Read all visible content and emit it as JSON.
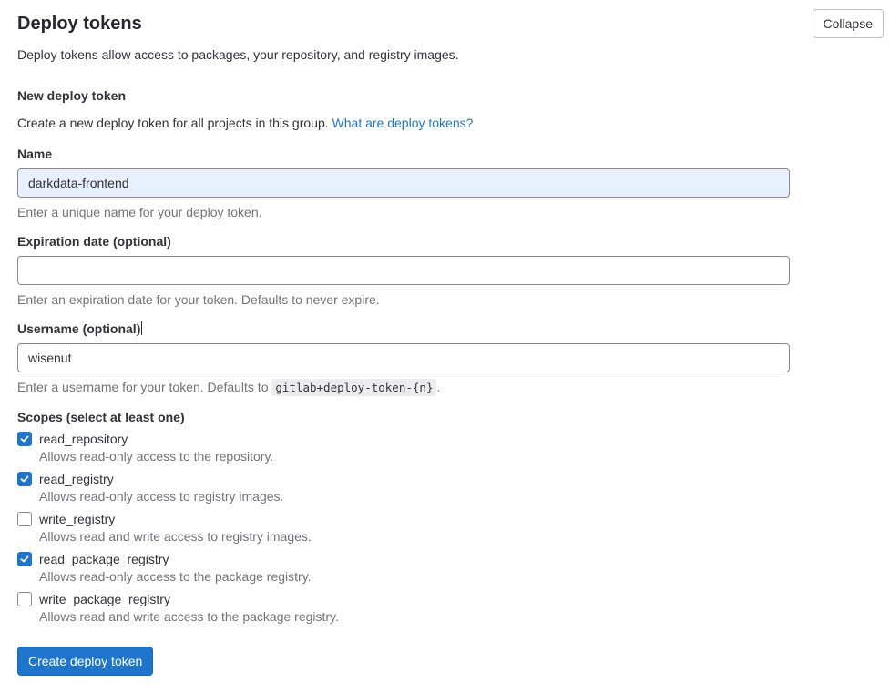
{
  "header": {
    "title": "Deploy tokens",
    "collapse_label": "Collapse",
    "description": "Deploy tokens allow access to packages, your repository, and registry images."
  },
  "new_token": {
    "heading": "New deploy token",
    "intro_text": "Create a new deploy token for all projects in this group.",
    "intro_link": "What are deploy tokens?"
  },
  "name_field": {
    "label": "Name",
    "value": "darkdata-frontend",
    "help": "Enter a unique name for your deploy token."
  },
  "expiration_field": {
    "label": "Expiration date (optional)",
    "value": "",
    "help": "Enter an expiration date for your token. Defaults to never expire."
  },
  "username_field": {
    "label": "Username (optional)",
    "value": "wisenut",
    "help_prefix": "Enter a username for your token. Defaults to",
    "help_code": "gitlab+deploy-token-{n}",
    "help_suffix": "."
  },
  "scopes": {
    "heading": "Scopes (select at least one)",
    "items": [
      {
        "name": "read_repository",
        "description": "Allows read-only access to the repository.",
        "checked": true
      },
      {
        "name": "read_registry",
        "description": "Allows read-only access to registry images.",
        "checked": true
      },
      {
        "name": "write_registry",
        "description": "Allows read and write access to registry images.",
        "checked": false
      },
      {
        "name": "read_package_registry",
        "description": "Allows read-only access to the package registry.",
        "checked": true
      },
      {
        "name": "write_package_registry",
        "description": "Allows read and write access to the package registry.",
        "checked": false
      }
    ]
  },
  "submit_label": "Create deploy token",
  "colors": {
    "accent": "#1f75cb",
    "autofill_bg": "#e8f0fe",
    "muted_text": "#737278"
  }
}
